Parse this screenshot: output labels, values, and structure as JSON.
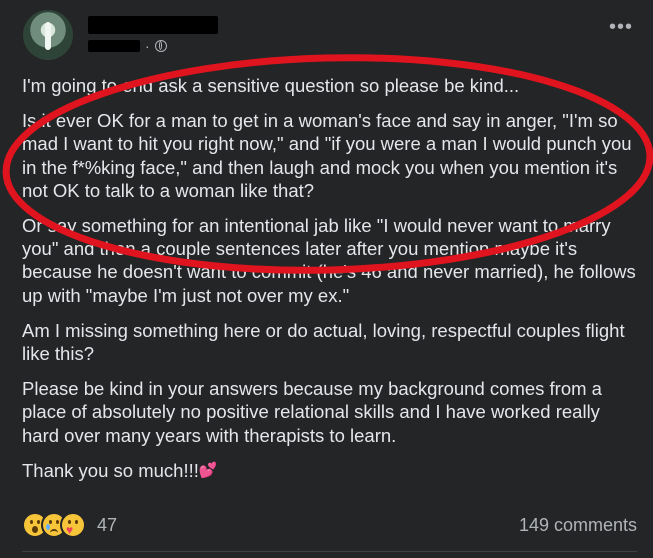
{
  "post": {
    "paragraphs": [
      "I'm going to end ask a sensitive question so please be kind...",
      "Is it ever OK for a man to get in a woman's face and say in anger, \"I'm so mad I want to hit you right now,\" and \"if you were a man I would punch you in the f*%king face,\" and then laugh and mock you when you mention it's not OK to talk to a woman like that?",
      "Or say something for an intentional jab like \"I would never want to marry you\" and then a couple sentences later after you mention maybe it's because he doesn't want to commit (he's 46 and never married), he follows up with \"maybe I'm just not over my ex.\"",
      "Am I missing something here or do actual, loving, respectful couples flight like this?",
      "Please be kind in your answers because my background comes from a place of absolutely no positive relational skills and I have worked really hard over many years with therapists to learn.",
      "Thank you so much!!!"
    ],
    "closing_emoji": "💕",
    "header": {
      "separator": "·"
    }
  },
  "footer": {
    "reaction_count": "47",
    "comments": "149 comments",
    "reaction_names": [
      "wow",
      "sad",
      "care"
    ]
  },
  "icons": {
    "more": "more-options-icon",
    "audience": "globe-icon"
  },
  "colors": {
    "background": "#242526",
    "text": "#e4e6eb",
    "muted": "#b0b3b8",
    "annotation": "#e0141e"
  }
}
